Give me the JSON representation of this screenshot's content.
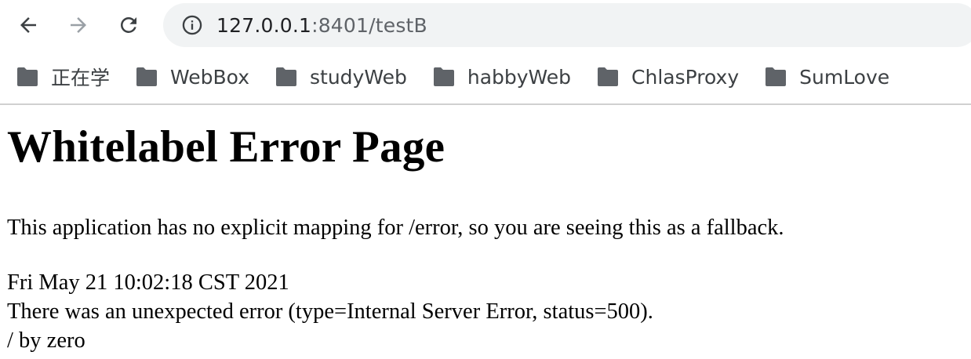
{
  "browser": {
    "icons": {
      "back": "back-arrow-icon",
      "forward": "forward-arrow-icon",
      "reload": "reload-icon",
      "info": "info-icon",
      "folder": "folder-icon"
    },
    "address": {
      "host": "127.0.0.1",
      "rest": ":8401/testB"
    },
    "bookmarks": [
      {
        "label": "正在学"
      },
      {
        "label": "WebBox"
      },
      {
        "label": "studyWeb"
      },
      {
        "label": "habbyWeb"
      },
      {
        "label": "ChlasProxy"
      },
      {
        "label": "SumLove"
      }
    ],
    "colors": {
      "icon": "#3c4043",
      "icon_disabled": "#9aa0a6",
      "folder": "#5f6368",
      "omnibox_bg": "#f1f3f4"
    }
  },
  "page": {
    "title": "Whitelabel Error Page",
    "message": "This application has no explicit mapping for /error, so you are seeing this as a fallback.",
    "timestamp": "Fri May 21 10:02:18 CST 2021",
    "error_line": "There was an unexpected error (type=Internal Server Error, status=500).",
    "error_detail": "/ by zero"
  }
}
